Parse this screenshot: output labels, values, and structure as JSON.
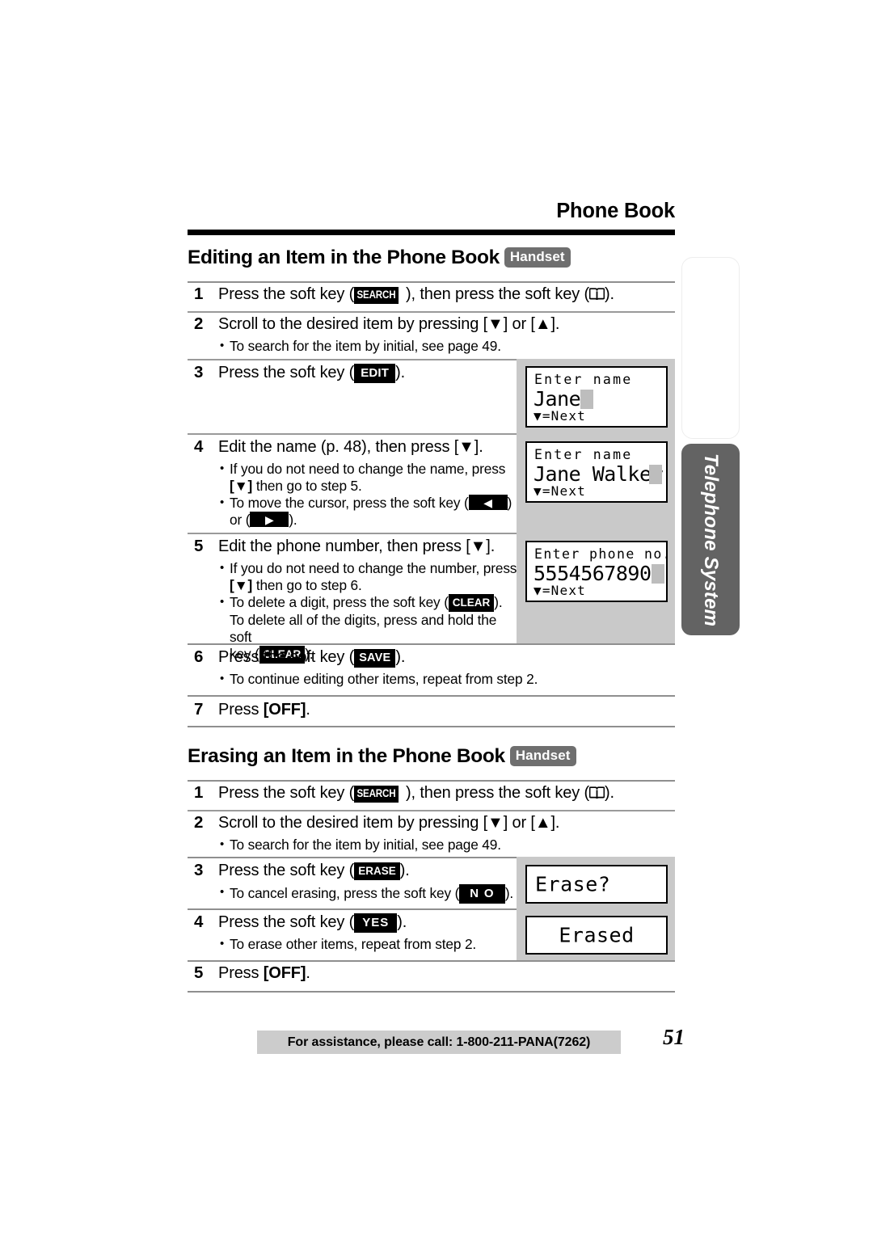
{
  "header": {
    "running_head": "Phone Book"
  },
  "sections": [
    {
      "id": "editing",
      "title": "Editing an Item in the Phone Book",
      "badge": "Handset",
      "steps": [
        {
          "num": "1",
          "text_a": "Press the soft key (",
          "softkey": "SEARCH",
          "text_b": "), then press the soft key (",
          "icon": "phone-book-icon",
          "text_c": ").",
          "bullets": []
        },
        {
          "num": "2",
          "text_a": "Scroll to the desired item by pressing [",
          "key_a": "▼",
          "text_b": "] or [",
          "key_b": "▲",
          "text_c": "].",
          "bullets": [
            "To search for the item by initial, see page 49."
          ]
        },
        {
          "num": "3",
          "text_a": "Press the soft key (",
          "softkey": "EDIT",
          "text_b": ").",
          "bullets": []
        },
        {
          "num": "4",
          "text_a": "Edit the name (p. 48), then press [",
          "key_a": "▼",
          "text_b": "].",
          "bullets": [
            "If you do not need to change the name, press [▼] then go to step 5.",
            "To move the cursor, press the soft key (◀) or (▶)."
          ]
        },
        {
          "num": "5",
          "text_a": "Edit the phone number, then press [",
          "key_a": "▼",
          "text_b": "].",
          "bullets": [
            "If you do not need to change the number, press [▼] then go to step 6.",
            "To delete a digit, press the soft key (CLEAR). To delete all of the digits, press and hold the soft key (CLEAR)."
          ]
        },
        {
          "num": "6",
          "text_a": "Press the soft key (",
          "softkey": "SAVE",
          "text_b": ").",
          "bullets": [
            "To continue editing other items, repeat from step 2."
          ]
        },
        {
          "num": "7",
          "text_a": "Press ",
          "key_a": "[OFF]",
          "text_b": ".",
          "bullets": []
        }
      ]
    },
    {
      "id": "erasing",
      "title": "Erasing an Item in the Phone Book",
      "badge": "Handset",
      "steps": [
        {
          "num": "1",
          "text_a": "Press the soft key (",
          "softkey": "SEARCH",
          "text_b": "), then press the soft key (",
          "icon": "phone-book-icon",
          "text_c": ").",
          "bullets": []
        },
        {
          "num": "2",
          "text_a": "Scroll to the desired item by pressing [",
          "key_a": "▼",
          "text_b": "] or [",
          "key_b": "▲",
          "text_c": "].",
          "bullets": [
            "To search for the item by initial, see page 49."
          ]
        },
        {
          "num": "3",
          "text_a": "Press the soft key (",
          "softkey": "ERASE",
          "text_b": ").",
          "bullets": [
            "To cancel erasing, press the soft key (NO)."
          ]
        },
        {
          "num": "4",
          "text_a": "Press the soft key (",
          "softkey": "YES",
          "text_b": ").",
          "bullets": [
            "To erase other items, repeat from step 2."
          ]
        },
        {
          "num": "5",
          "text_a": "Press ",
          "key_a": "[OFF]",
          "text_b": ".",
          "bullets": []
        }
      ]
    }
  ],
  "displays": {
    "edit_name_1": {
      "line1": "Enter name",
      "line2": "Jane",
      "line3": "▼=Next",
      "cursor": true
    },
    "edit_name_2": {
      "line1": "Enter name",
      "line2": "Jane Walker",
      "line3": "▼=Next",
      "cursor": true
    },
    "edit_phone": {
      "line1": "Enter phone no.",
      "line2": "5554567890",
      "line3": "▼=Next",
      "cursor": true
    },
    "erase_confirm": {
      "line1": "Erase?"
    },
    "erased": {
      "line1": "Erased"
    }
  },
  "side_tab": {
    "label": "Telephone System"
  },
  "footer": {
    "assistance": "For assistance, please call: 1-800-211-PANA(7262)",
    "page_number": "51"
  },
  "softkey_labels": {
    "search": "SEARCH",
    "edit": "EDIT",
    "clear": "CLEAR",
    "save": "SAVE",
    "erase": "ERASE",
    "no": "N O",
    "yes": "YES"
  },
  "colors": {
    "badge_gray": "#6f6f6f",
    "tab_gray": "#636363",
    "lcd_panel_gray": "#c9c9c9",
    "footer_gray": "#cccccc",
    "rule_gray": "#8f8f8f"
  }
}
